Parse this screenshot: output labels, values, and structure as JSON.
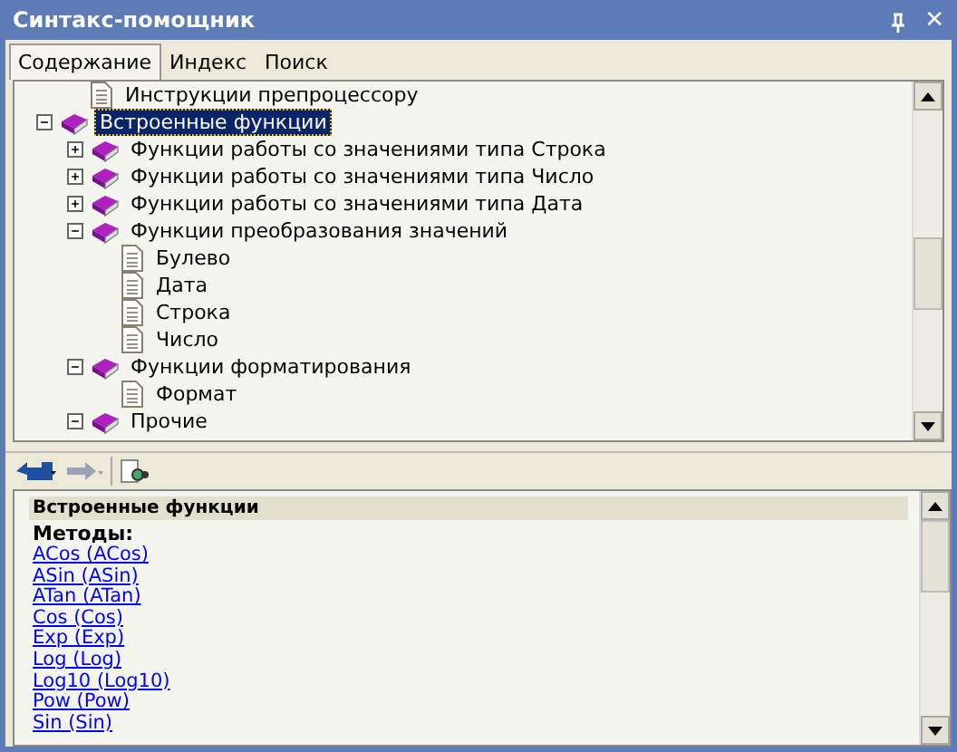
{
  "window": {
    "title": "Синтакс-помощник",
    "close": "✕"
  },
  "tabs": [
    {
      "label": "Содержание",
      "selected": true
    },
    {
      "label": "Индекс",
      "selected": false
    },
    {
      "label": "Поиск",
      "selected": false
    }
  ],
  "tree": [
    {
      "label": "Инструкции препроцессору",
      "kind": "page",
      "selected": false
    },
    {
      "label": "Встроенные функции",
      "kind": "book",
      "expanded": true,
      "selected": true,
      "children": [
        {
          "label": "Функции работы со значениями типа Строка",
          "kind": "book",
          "expanded": false,
          "selected": false
        },
        {
          "label": "Функции работы со значениями типа Число",
          "kind": "book",
          "expanded": false,
          "selected": false
        },
        {
          "label": "Функции работы со значениями типа Дата",
          "kind": "book",
          "expanded": false,
          "selected": false
        },
        {
          "label": "Функции преобразования значений",
          "kind": "book",
          "expanded": true,
          "selected": false,
          "children": [
            {
              "label": "Булево",
              "kind": "page",
              "selected": false
            },
            {
              "label": "Дата",
              "kind": "page",
              "selected": false
            },
            {
              "label": "Строка",
              "kind": "page",
              "selected": false
            },
            {
              "label": "Число",
              "kind": "page",
              "selected": false
            }
          ]
        },
        {
          "label": "Функции форматирования",
          "kind": "book",
          "expanded": true,
          "selected": false,
          "children": [
            {
              "label": "Формат",
              "kind": "page",
              "selected": false
            }
          ]
        },
        {
          "label": "Прочие",
          "kind": "book",
          "expanded": true,
          "selected": false
        }
      ]
    }
  ],
  "help": {
    "heading": "Встроенные функции",
    "section": "Методы:",
    "links": [
      "ACos (ACos)",
      "ASin (ASin)",
      "ATan (ATan)",
      "Cos (Cos)",
      "Exp (Exp)",
      "Log (Log)",
      "Log10 (Log10)",
      "Pow (Pow)",
      "Sin (Sin)"
    ]
  }
}
